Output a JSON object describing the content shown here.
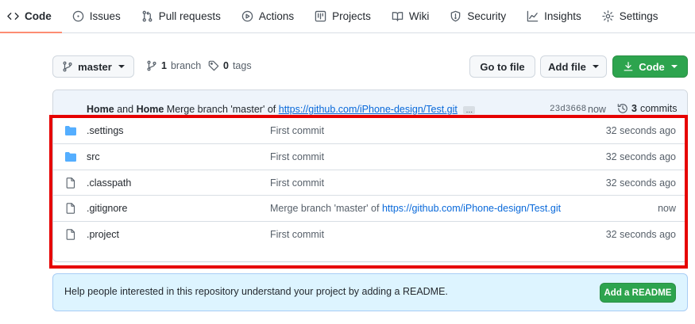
{
  "nav": {
    "tabs": [
      {
        "label": "Code",
        "icon": "code-icon",
        "active": true
      },
      {
        "label": "Issues",
        "icon": "issue-icon"
      },
      {
        "label": "Pull requests",
        "icon": "pull-request-icon"
      },
      {
        "label": "Actions",
        "icon": "play-icon"
      },
      {
        "label": "Projects",
        "icon": "project-icon"
      },
      {
        "label": "Wiki",
        "icon": "book-icon"
      },
      {
        "label": "Security",
        "icon": "shield-icon"
      },
      {
        "label": "Insights",
        "icon": "graph-icon"
      },
      {
        "label": "Settings",
        "icon": "gear-icon"
      }
    ]
  },
  "toolbar": {
    "branch_label": "master",
    "branch_count": "1",
    "branch_word": "branch",
    "tag_count": "0",
    "tag_word": "tags",
    "go_to_file_label": "Go to file",
    "add_file_label": "Add file",
    "code_label": "Code"
  },
  "commit": {
    "author1": "Home",
    "and_word": "and",
    "author2": "Home",
    "message_prefix": "Merge branch 'master' of",
    "message_link": "https://github.com/iPhone-design/Test.git",
    "ellipsis": "…",
    "sha": "23d3668",
    "time": "now",
    "count": "3",
    "count_word": "commits"
  },
  "files": [
    {
      "type": "folder",
      "name": ".settings",
      "message": "First commit",
      "link": "",
      "time": "32 seconds ago"
    },
    {
      "type": "folder",
      "name": "src",
      "message": "First commit",
      "link": "",
      "time": "32 seconds ago"
    },
    {
      "type": "file",
      "name": ".classpath",
      "message": "First commit",
      "link": "",
      "time": "32 seconds ago"
    },
    {
      "type": "file",
      "name": ".gitignore",
      "message": "Merge branch 'master' of ",
      "link": "https://github.com/iPhone-design/Test.git",
      "time": "now"
    },
    {
      "type": "file",
      "name": ".project",
      "message": "First commit",
      "link": "",
      "time": "32 seconds ago"
    }
  ],
  "readme": {
    "text": "Help people interested in this repository understand your project by adding a README.",
    "button_label": "Add a README"
  },
  "colors": {
    "accent_green": "#2da44e",
    "link_blue": "#0969da",
    "folder_blue": "#54aeff",
    "highlight_red": "#e60000",
    "active_tab_underline": "#fd8c73"
  }
}
